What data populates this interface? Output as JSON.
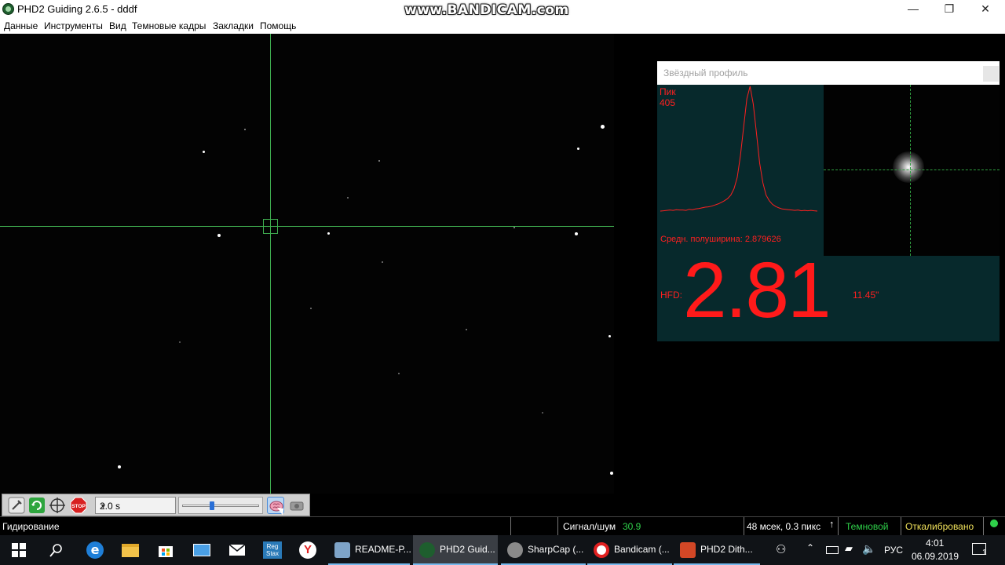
{
  "window": {
    "title": "PHD2 Guiding 2.6.5 - dddf",
    "watermark": "www.BANDICAM.com",
    "minimize": "—",
    "maximize": "❐",
    "close": "✕"
  },
  "menu": [
    "Данные",
    "Инструменты",
    "Вид",
    "Темновые кадры",
    "Закладки",
    "Помощь"
  ],
  "profile": {
    "title": "Звёздный профиль",
    "peak_label": "Пик",
    "peak_value": "405",
    "fwhm_text": "Средн. полуширина: 2.879626",
    "hfd_label": "HFD:",
    "hfd_value": "2.81",
    "hfd_arcsec": "11.45\"",
    "profile_values": [
      55,
      56,
      57,
      58,
      57,
      59,
      58,
      58,
      57,
      60,
      59,
      61,
      62,
      64,
      66,
      67,
      69,
      72,
      75,
      79,
      84,
      90,
      100,
      118,
      150,
      210,
      290,
      370,
      405,
      355,
      275,
      190,
      135,
      100,
      84,
      74,
      68,
      64,
      61,
      60,
      59,
      58,
      57,
      58,
      56,
      57,
      56,
      57,
      56,
      55
    ]
  },
  "toolbar": {
    "exposure": "2.0 s",
    "slider_value": 0.38,
    "icons": [
      "gear-icon",
      "loop-icon",
      "crosshair-icon",
      "stop-icon",
      "brain-icon",
      "camera-icon"
    ],
    "stop_label": "STOP"
  },
  "status": {
    "mode": "Гидирование",
    "snr_label": "Сигнал/шум",
    "snr_value": "30.9",
    "timing": "48 мсек, 0.3 пикс",
    "dark": "Темновой",
    "calibrated": "Откалибровано",
    "color_green": "#2fd04a",
    "color_yellow": "#f2e35c"
  },
  "taskbar": {
    "apps": [
      {
        "label": "README-P...",
        "icon": "book-icon"
      },
      {
        "label": "PHD2 Guid...",
        "icon": "phd2-icon"
      },
      {
        "label": "SharpCap (...",
        "icon": "sharpcap-icon"
      },
      {
        "label": "Bandicam (...",
        "icon": "record-icon"
      },
      {
        "label": "PHD2 Dith...",
        "icon": "powerpoint-icon"
      }
    ],
    "regstax_label": "Reg Stax",
    "yandex_label": "Y",
    "lang": "РУС",
    "time": "4:01",
    "date": "06.09.2019",
    "notif_count": "1"
  }
}
